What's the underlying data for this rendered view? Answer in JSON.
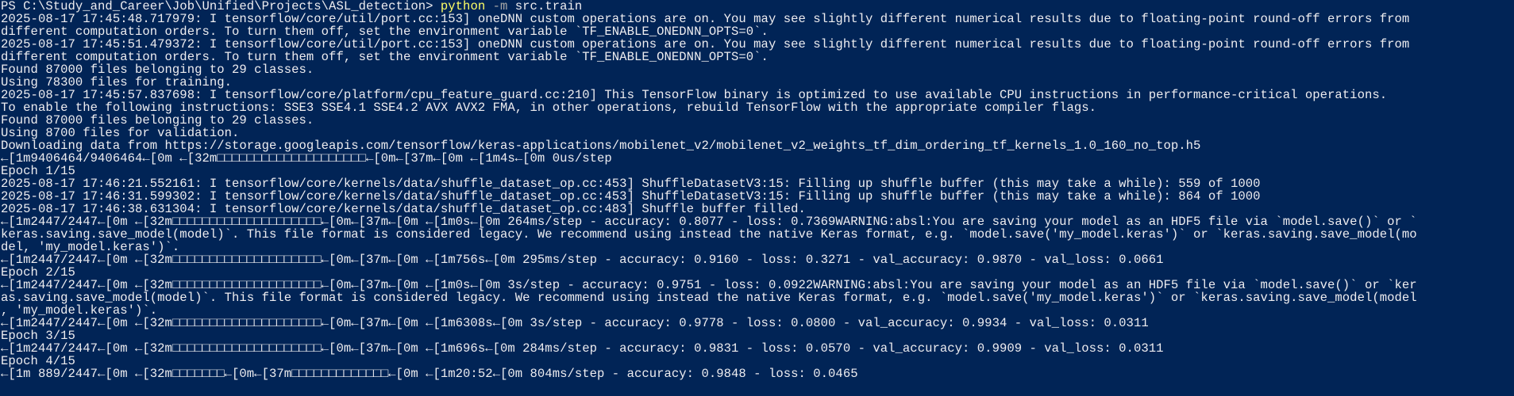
{
  "window": {
    "theme": "PowerShell console",
    "background": "#012456",
    "foreground": "#eeedf0",
    "command_color": "#ffff66",
    "param_color": "#a8a8a8"
  },
  "prompt": {
    "path": "PS C:\\Study_and_Career\\Job\\Unified\\Projects\\ASL_detection> ",
    "command": "python",
    "flag": " -m",
    "argument": " src.train"
  },
  "lines": [
    "2025-08-17 17:45:48.717979: I tensorflow/core/util/port.cc:153] oneDNN custom operations are on. You may see slightly different numerical results due to floating-point round-off errors from",
    "different computation orders. To turn them off, set the environment variable `TF_ENABLE_ONEDNN_OPTS=0`.",
    "2025-08-17 17:45:51.479372: I tensorflow/core/util/port.cc:153] oneDNN custom operations are on. You may see slightly different numerical results due to floating-point round-off errors from",
    "different computation orders. To turn them off, set the environment variable `TF_ENABLE_ONEDNN_OPTS=0`.",
    "Found 87000 files belonging to 29 classes.",
    "Using 78300 files for training.",
    "2025-08-17 17:45:57.837698: I tensorflow/core/platform/cpu_feature_guard.cc:210] This TensorFlow binary is optimized to use available CPU instructions in performance-critical operations.",
    "To enable the following instructions: SSE3 SSE4.1 SSE4.2 AVX AVX2 FMA, in other operations, rebuild TensorFlow with the appropriate compiler flags.",
    "Found 87000 files belonging to 29 classes.",
    "Using 8700 files for validation.",
    "Downloading data from https://storage.googleapis.com/tensorflow/keras-applications/mobilenet_v2/mobilenet_v2_weights_tf_dim_ordering_tf_kernels_1.0_160_no_top.h5",
    "←[1m9406464/9406464←[0m ←[32m□□□□□□□□□□□□□□□□□□□□←[0m←[37m←[0m ←[1m4s←[0m 0us/step",
    "Epoch 1/15",
    "2025-08-17 17:46:21.552161: I tensorflow/core/kernels/data/shuffle_dataset_op.cc:453] ShuffleDatasetV3:15: Filling up shuffle buffer (this may take a while): 559 of 1000",
    "2025-08-17 17:46:31.599302: I tensorflow/core/kernels/data/shuffle_dataset_op.cc:453] ShuffleDatasetV3:15: Filling up shuffle buffer (this may take a while): 864 of 1000",
    "2025-08-17 17:46:38.631304: I tensorflow/core/kernels/data/shuffle_dataset_op.cc:483] Shuffle buffer filled.",
    "←[1m2447/2447←[0m ←[32m□□□□□□□□□□□□□□□□□□□□←[0m←[37m←[0m ←[1m0s←[0m 264ms/step - accuracy: 0.8077 - loss: 0.7369WARNING:absl:You are saving your model as an HDF5 file via `model.save()` or `",
    "keras.saving.save_model(model)`. This file format is considered legacy. We recommend using instead the native Keras format, e.g. `model.save('my_model.keras')` or `keras.saving.save_model(mo",
    "del, 'my_model.keras')`.",
    "←[1m2447/2447←[0m ←[32m□□□□□□□□□□□□□□□□□□□□←[0m←[37m←[0m ←[1m756s←[0m 295ms/step - accuracy: 0.9160 - loss: 0.3271 - val_accuracy: 0.9870 - val_loss: 0.0661",
    "Epoch 2/15",
    "←[1m2447/2447←[0m ←[32m□□□□□□□□□□□□□□□□□□□□←[0m←[37m←[0m ←[1m0s←[0m 3s/step - accuracy: 0.9751 - loss: 0.0922WARNING:absl:You are saving your model as an HDF5 file via `model.save()` or `ker",
    "as.saving.save_model(model)`. This file format is considered legacy. We recommend using instead the native Keras format, e.g. `model.save('my_model.keras')` or `keras.saving.save_model(model",
    ", 'my_model.keras')`.",
    "←[1m2447/2447←[0m ←[32m□□□□□□□□□□□□□□□□□□□□←[0m←[37m←[0m ←[1m6308s←[0m 3s/step - accuracy: 0.9778 - loss: 0.0800 - val_accuracy: 0.9934 - val_loss: 0.0311",
    "Epoch 3/15",
    "←[1m2447/2447←[0m ←[32m□□□□□□□□□□□□□□□□□□□□←[0m←[37m←[0m ←[1m696s←[0m 284ms/step - accuracy: 0.9831 - loss: 0.0570 - val_accuracy: 0.9909 - val_loss: 0.0311",
    "Epoch 4/15",
    "←[1m 889/2447←[0m ←[32m□□□□□□□←[0m←[37m□□□□□□□□□□□□□←[0m ←[1m20:52←[0m 804ms/step - accuracy: 0.9848 - loss: 0.0465"
  ]
}
